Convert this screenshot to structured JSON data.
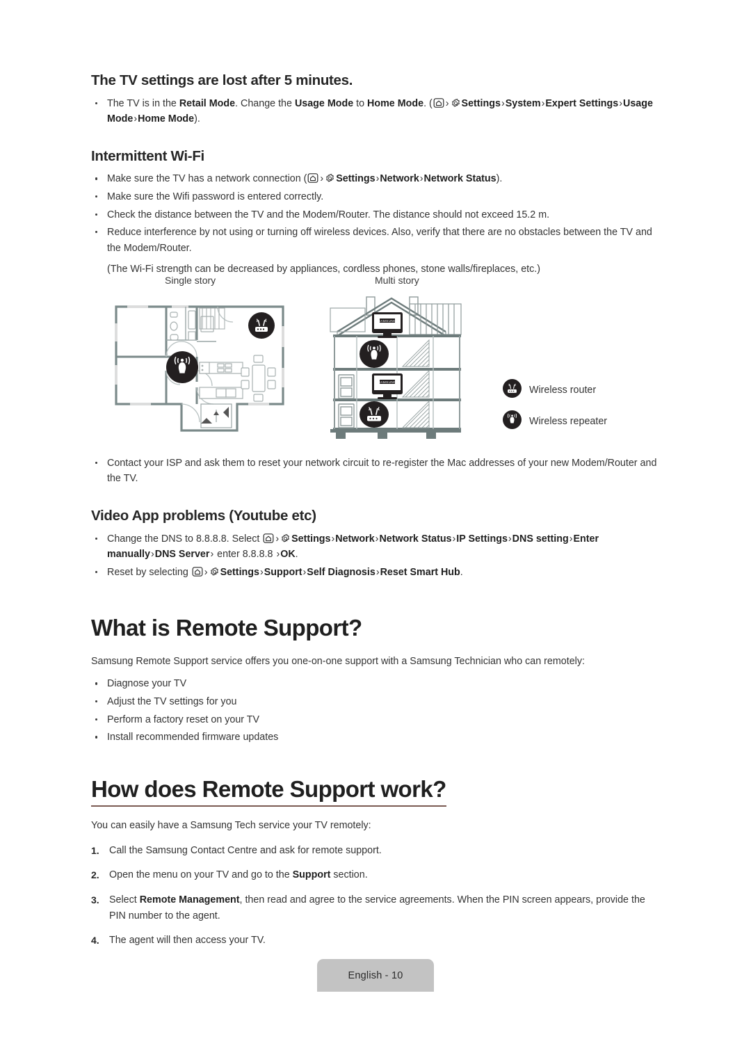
{
  "page": {
    "footer_label": "English - 10",
    "underline_color": "#7a5a52",
    "footer_bg": "#c3c3c3"
  },
  "sections": {
    "tv_settings_lost": {
      "heading": "The TV settings are lost after 5 minutes.",
      "bullet1": {
        "t1": "The TV is in the ",
        "b1": "Retail Mode",
        "t2": ". Change the ",
        "b2": "Usage Mode",
        "t3": " to ",
        "b3": "Home Mode",
        "t4": ". (",
        "icon_home": "home-icon",
        "icon_gear": "gear-icon",
        "b4": "Settings",
        "b5": "System",
        "b6": "Expert Settings",
        "b7": "Usage Mode",
        "b8": "Home Mode",
        "t5": ")."
      }
    },
    "intermittent_wifi": {
      "heading": "Intermittent Wi-Fi",
      "bullet1": {
        "t1": "Make sure the TV has a network connection (",
        "b1": "Settings",
        "b2": "Network",
        "b3": "Network Status",
        "t2": ")."
      },
      "bullet2": "Make sure the Wifi password is entered correctly.",
      "bullet3": "Check the distance between the TV and the Modem/Router. The distance should not exceed 15.2 m.",
      "bullet4": "Reduce interference by not using or turning off wireless devices. Also, verify that there are no obstacles between the TV and the Modem/Router.",
      "note": "(The Wi-Fi strength can be decreased by appliances, cordless phones, stone walls/fireplaces, etc.)",
      "diagram": {
        "label_single": "Single story",
        "label_multi": "Multi story",
        "legend": [
          {
            "icon": "wireless-router-icon",
            "label": "Wireless router"
          },
          {
            "icon": "wireless-repeater-icon",
            "label": "Wireless repeater"
          }
        ],
        "tv_brand": "SAMSUNG"
      },
      "bullet5": "Contact your ISP and ask them to reset your network circuit to re-register the Mac addresses of your new Modem/Router and the TV."
    },
    "video_app_problems": {
      "heading": "Video App problems (Youtube etc)",
      "bullet1": {
        "t1": "Change the DNS to 8.8.8.8. Select ",
        "b1": "Settings",
        "b2": "Network",
        "b3": "Network Status",
        "b4": "IP Settings",
        "b5": "DNS setting",
        "b6": "Enter manually",
        "b7": "DNS Server",
        "t2": " enter 8.8.8.8 ",
        "b8": "OK",
        "t3": "."
      },
      "bullet2": {
        "t1": "Reset by selecting ",
        "b1": "Settings",
        "b2": "Support",
        "b3": "Self Diagnosis",
        "b4": "Reset Smart Hub",
        "t2": "."
      }
    },
    "what_is_remote_support": {
      "heading": "What is Remote Support?",
      "lead": "Samsung Remote Support service offers you one-on-one support with a Samsung Technician who can remotely:",
      "items": [
        "Diagnose your TV",
        "Adjust the TV settings for you",
        "Perform a factory reset on your TV",
        "Install recommended firmware updates"
      ]
    },
    "how_does_remote_support_work": {
      "heading": "How does Remote Support work?",
      "lead": "You can easily have a Samsung Tech service your TV remotely:",
      "steps": [
        {
          "num": "1.",
          "t1": "Call the Samsung Contact Centre and ask for remote support."
        },
        {
          "num": "2.",
          "t1": "Open the menu on your TV and go to the ",
          "b1": "Support",
          "t2": " section."
        },
        {
          "num": "3.",
          "t1": "Select ",
          "b1": "Remote Management",
          "t2": ", then read and agree to the service agreements. When the PIN screen appears, provide the PIN number to the agent."
        },
        {
          "num": "4.",
          "t1": "The agent will then access your TV."
        }
      ]
    }
  }
}
